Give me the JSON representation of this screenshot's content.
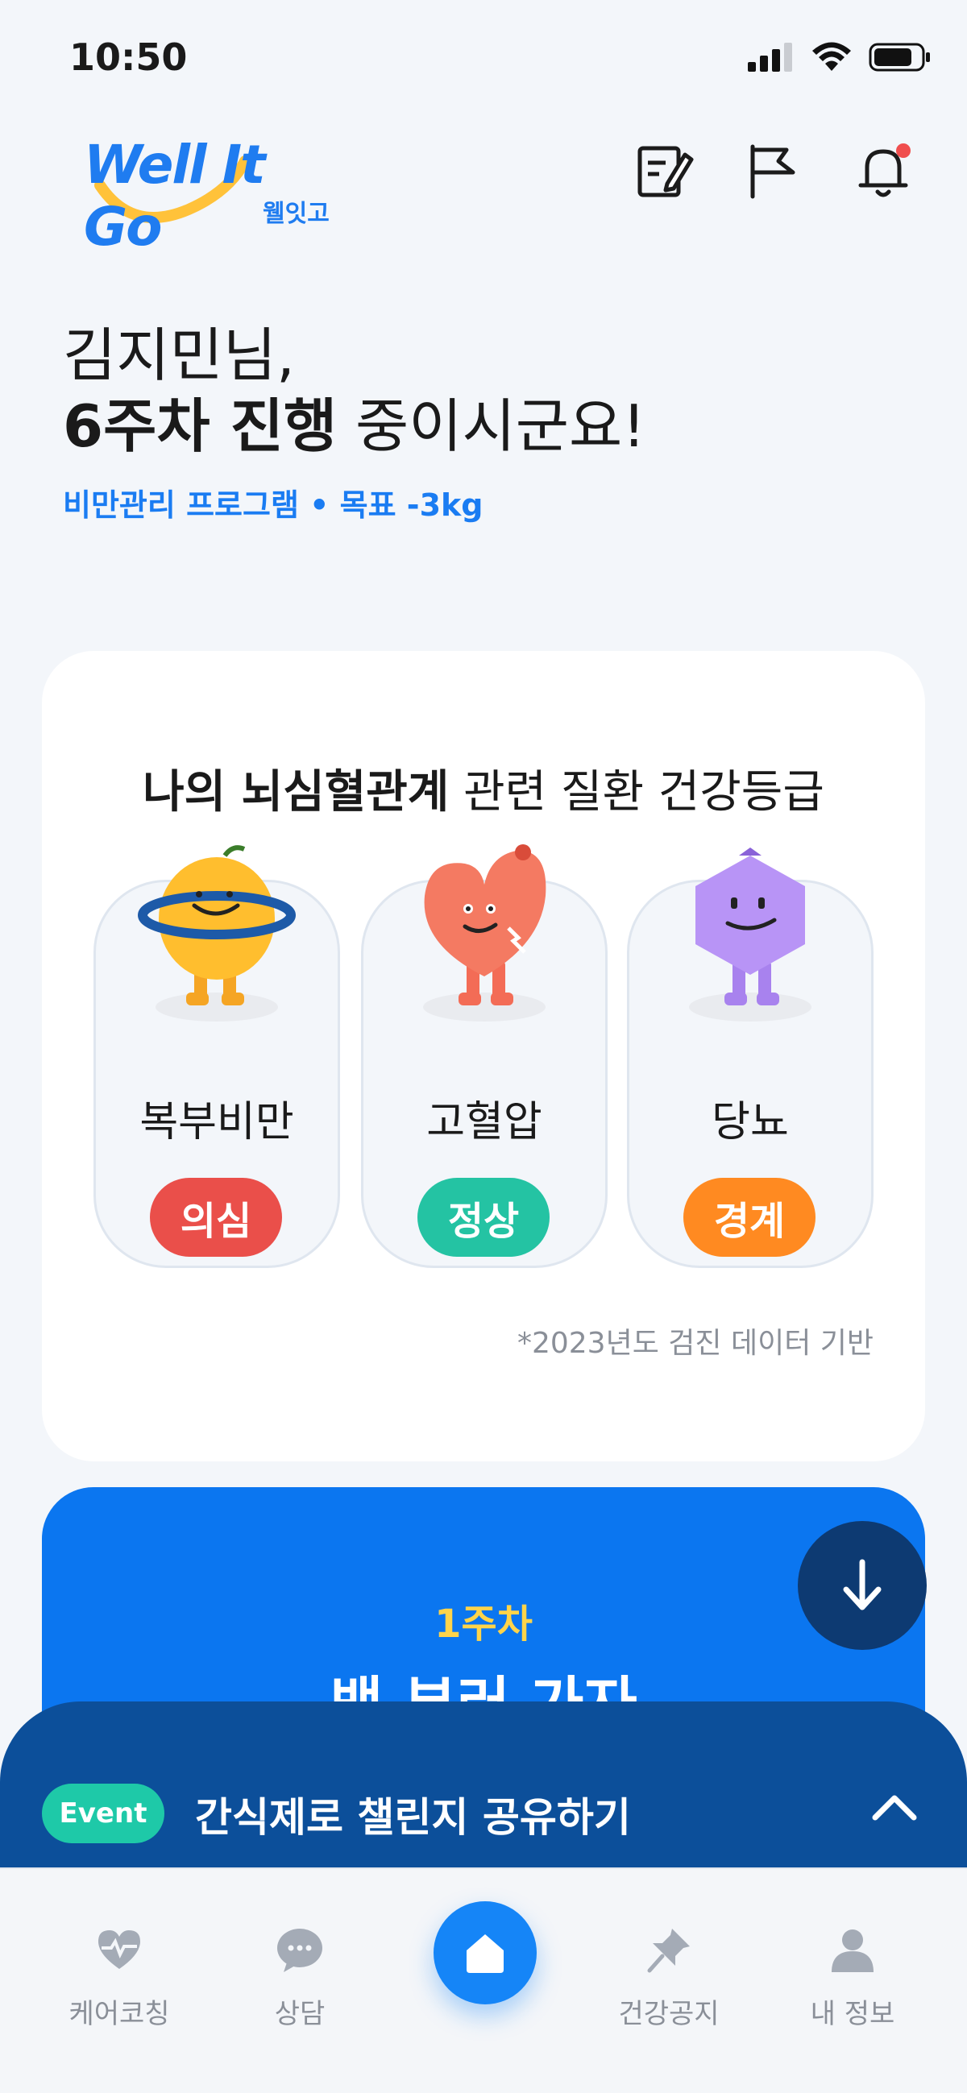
{
  "status": {
    "time": "10:50"
  },
  "header": {
    "logo_text": "Well It Go",
    "logo_sub": "웰잇고"
  },
  "greeting": {
    "line1": "김지민님,",
    "line2_bold": "6주차 진행",
    "line2_rest": " 중이시군요!",
    "program": "비만관리 프로그램 • 목표 -3kg"
  },
  "grade_card": {
    "title_bold": "나의 뇌심혈관계",
    "title_rest": " 관련 질환 건강등급",
    "items": [
      {
        "name": "복부비만",
        "grade": "의심",
        "color": "#ea4f4a"
      },
      {
        "name": "고혈압",
        "grade": "정상",
        "color": "#24c3a3"
      },
      {
        "name": "당뇨",
        "grade": "경계",
        "color": "#ff8a21"
      }
    ],
    "footnote": "*2023년도 검진 데이터 기반"
  },
  "week_card": {
    "week": "1주차",
    "title": "뱃 부러 가자"
  },
  "event": {
    "tag": "Event",
    "text": "간식제로 챌린지 공유하기"
  },
  "tabbar": {
    "items": [
      {
        "label": "케어코칭",
        "icon": "heart-pulse-icon"
      },
      {
        "label": "상담",
        "icon": "chat-bubble-icon"
      },
      {
        "label": "",
        "icon": "home-icon"
      },
      {
        "label": "건강공지",
        "icon": "pin-icon"
      },
      {
        "label": "내 정보",
        "icon": "person-icon"
      }
    ]
  },
  "colors": {
    "brand_blue": "#1a7cf2",
    "event_bar": "#0c4f9a",
    "week_card": "#0b76f0"
  }
}
